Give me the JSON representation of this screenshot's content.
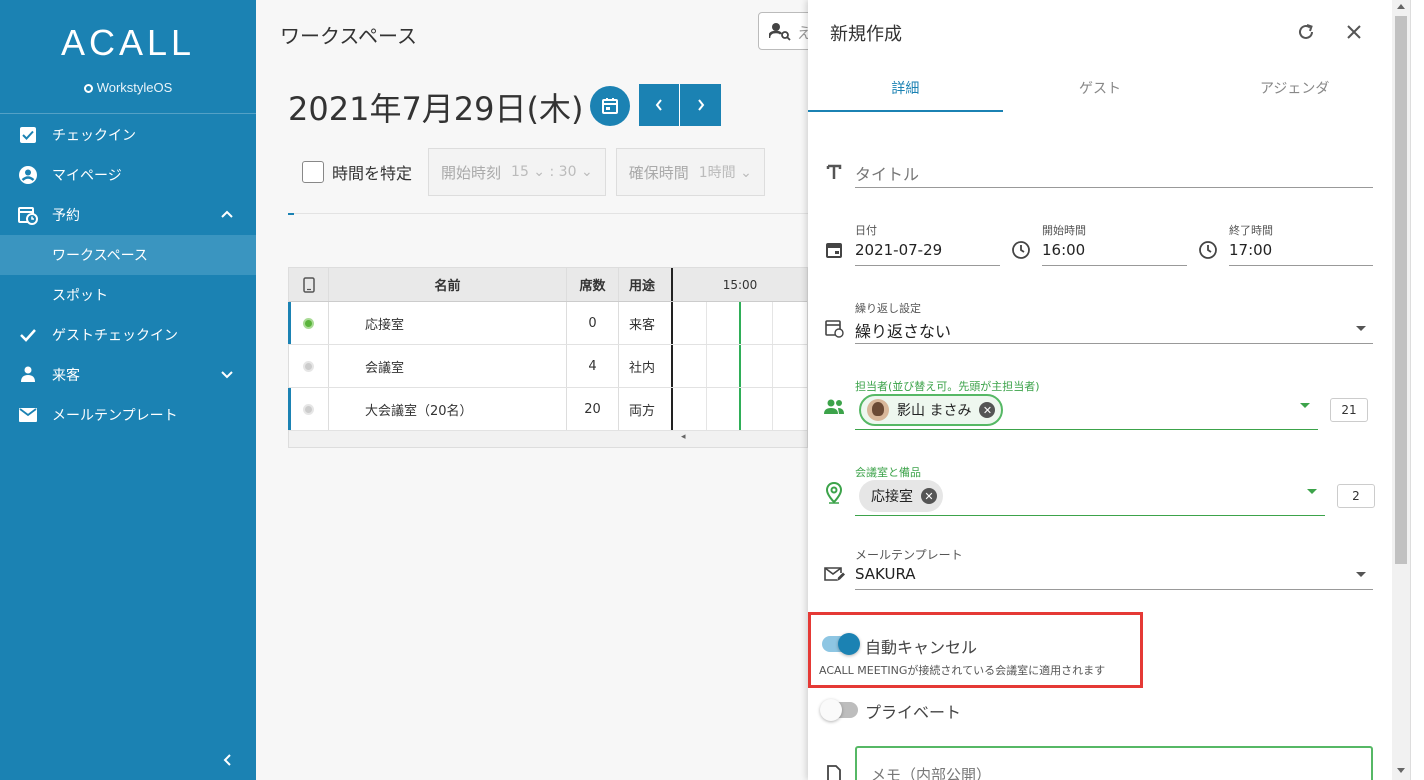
{
  "sidebar": {
    "logo": "ACALL",
    "logo_sub": "WorkstyleOS",
    "items": [
      {
        "label": "チェックイン"
      },
      {
        "label": "マイページ"
      },
      {
        "label": "予約"
      },
      {
        "label": "ワークスペース"
      },
      {
        "label": "スポット"
      },
      {
        "label": "ゲストチェックイン"
      },
      {
        "label": "来客"
      },
      {
        "label": "メールテンプレート"
      }
    ]
  },
  "main": {
    "heading": "ワークスペース",
    "search_placeholder": "え",
    "date_title": "2021年7月29日(木)",
    "filter": {
      "time_check_label": "時間を特定",
      "start_label": "開始時刻",
      "start_hour": "15",
      "start_min": "30",
      "duration_label": "確保時間",
      "duration_value": "1時間"
    },
    "table": {
      "headers": {
        "name": "名前",
        "seats": "席数",
        "use": "用途",
        "time": "15:00"
      },
      "rows": [
        {
          "name": "応接室",
          "seats": "0",
          "use": "来客",
          "active": true
        },
        {
          "name": "会議室",
          "seats": "4",
          "use": "社内",
          "active": false
        },
        {
          "name": "大会議室（20名）",
          "seats": "20",
          "use": "両方",
          "active": false
        }
      ]
    }
  },
  "panel": {
    "title": "新規作成",
    "tabs": [
      "詳細",
      "ゲスト",
      "アジェンダ"
    ],
    "title_placeholder": "タイトル",
    "date": {
      "label": "日付",
      "value": "2021-07-29"
    },
    "start": {
      "label": "開始時間",
      "value": "16:00"
    },
    "end": {
      "label": "終了時間",
      "value": "17:00"
    },
    "repeat": {
      "label": "繰り返し設定",
      "value": "繰り返さない"
    },
    "owner": {
      "label": "担当者(並び替え可。先頭が主担当者)",
      "chip": "影山 まさみ",
      "count": "21"
    },
    "room": {
      "label": "会議室と備品",
      "chip": "応接室",
      "count": "2"
    },
    "mail": {
      "label": "メールテンプレート",
      "value": "SAKURA"
    },
    "auto_cancel": {
      "label": "自動キャンセル",
      "note": "ACALL MEETINGが接続されている会議室に適用されます"
    },
    "private_label": "プライベート",
    "memo_placeholder": "メモ（内部公開）"
  },
  "colors": {
    "brand": "#1b82b3",
    "green": "#3ca34a",
    "highlight": "#e53935"
  }
}
